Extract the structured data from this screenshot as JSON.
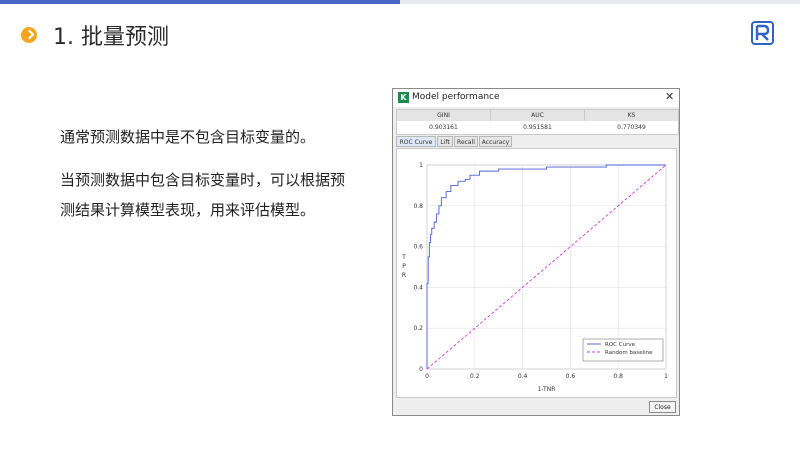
{
  "slide": {
    "heading": "1. 批量预测",
    "paragraph1": "通常预测数据中是不包含目标变量的。",
    "paragraph2": "当预测数据中包含目标变量时，可以根据预测结果计算模型表现，用来评估模型。",
    "colors": {
      "accent": "#4a67c4",
      "bullet": "#f2a51f",
      "logo": "#2f63c4"
    }
  },
  "dialog": {
    "title": "Model performance",
    "close_x": "✕",
    "metrics": [
      {
        "name": "GINI",
        "value": "0.903161"
      },
      {
        "name": "AUC",
        "value": "0.951581"
      },
      {
        "name": "KS",
        "value": "0.770349"
      }
    ],
    "tabs": [
      "ROC Curve",
      "Lift",
      "Recall",
      "Accuracy"
    ],
    "active_tab": "ROC Curve",
    "close_button": "Close",
    "icons": {
      "app": "k-icon",
      "window_close": "close-icon"
    }
  },
  "chart_data": {
    "type": "line",
    "title": "",
    "xlabel": "1-TNR",
    "ylabel": "TPR",
    "xlim": [
      0,
      1
    ],
    "ylim": [
      0,
      1
    ],
    "xticks": [
      "0",
      "0.2",
      "0.4",
      "0.6",
      "0.8",
      "1"
    ],
    "yticks": [
      "0",
      "0.2",
      "0.4",
      "0.6",
      "0.8",
      "1"
    ],
    "grid": true,
    "legend_position": "bottom-right",
    "series": [
      {
        "name": "ROC Curve",
        "color": "#4b5fd6",
        "style": "solid",
        "x": [
          0,
          0,
          0.005,
          0.005,
          0.01,
          0.01,
          0.015,
          0.015,
          0.02,
          0.02,
          0.03,
          0.03,
          0.04,
          0.04,
          0.05,
          0.05,
          0.06,
          0.06,
          0.08,
          0.08,
          0.1,
          0.1,
          0.13,
          0.13,
          0.16,
          0.16,
          0.18,
          0.18,
          0.22,
          0.22,
          0.3,
          0.3,
          0.5,
          0.5,
          0.75,
          0.75,
          1
        ],
        "y": [
          0,
          0.42,
          0.42,
          0.55,
          0.55,
          0.62,
          0.62,
          0.66,
          0.66,
          0.69,
          0.69,
          0.72,
          0.72,
          0.76,
          0.76,
          0.8,
          0.8,
          0.84,
          0.84,
          0.87,
          0.87,
          0.9,
          0.9,
          0.92,
          0.92,
          0.93,
          0.93,
          0.95,
          0.95,
          0.97,
          0.97,
          0.98,
          0.98,
          0.99,
          0.99,
          1,
          1
        ]
      },
      {
        "name": "Random baseline",
        "color": "#d63ad6",
        "style": "dashed",
        "x": [
          0,
          1
        ],
        "y": [
          0,
          1
        ]
      }
    ]
  }
}
